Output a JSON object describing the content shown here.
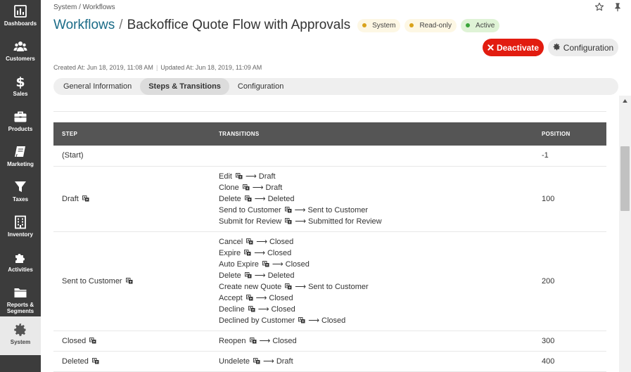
{
  "sidebar": {
    "items": [
      {
        "label": "Dashboards",
        "icon": "bar-chart-icon"
      },
      {
        "label": "Customers",
        "icon": "users-icon"
      },
      {
        "label": "Sales",
        "icon": "dollar-icon"
      },
      {
        "label": "Products",
        "icon": "briefcase-icon"
      },
      {
        "label": "Marketing",
        "icon": "book-icon"
      },
      {
        "label": "Taxes",
        "icon": "filter-icon"
      },
      {
        "label": "Inventory",
        "icon": "building-icon"
      },
      {
        "label": "Activities",
        "icon": "puzzle-icon"
      },
      {
        "label": "Reports &",
        "label2": "Segments",
        "icon": "folder-icon"
      },
      {
        "label": "System",
        "icon": "gear-icon"
      }
    ]
  },
  "breadcrumb": "System / Workflows",
  "title": {
    "link": "Workflows",
    "separator": "/",
    "name": "Backoffice Quote Flow with Approvals"
  },
  "badges": [
    {
      "label": "System",
      "type": "warn"
    },
    {
      "label": "Read-only",
      "type": "warn"
    },
    {
      "label": "Active",
      "type": "ok"
    }
  ],
  "buttons": {
    "deactivate": "Deactivate",
    "configuration": "Configuration"
  },
  "meta": {
    "created": "Created At: Jun 18, 2019, 11:08 AM",
    "divider": "|",
    "updated": "Updated At: Jun 18, 2019, 11:09 AM"
  },
  "tabs": [
    {
      "label": "General Information",
      "active": false
    },
    {
      "label": "Steps & Transitions",
      "active": true
    },
    {
      "label": "Configuration",
      "active": false
    }
  ],
  "table": {
    "headers": {
      "step": "STEP",
      "transitions": "TRANSITIONS",
      "position": "POSITION"
    },
    "arrow": "⟶",
    "rows": [
      {
        "step": "(Start)",
        "step_icon": false,
        "position": "-1",
        "transitions": []
      },
      {
        "step": "Draft",
        "step_icon": true,
        "position": "100",
        "transitions": [
          {
            "name": "Edit",
            "target": "Draft"
          },
          {
            "name": "Clone",
            "target": "Draft"
          },
          {
            "name": "Delete",
            "target": "Deleted"
          },
          {
            "name": "Send to Customer",
            "target": "Sent to Customer"
          },
          {
            "name": "Submit for Review",
            "target": "Submitted for Review"
          }
        ]
      },
      {
        "step": "Sent to Customer",
        "step_icon": true,
        "position": "200",
        "transitions": [
          {
            "name": "Cancel",
            "target": "Closed"
          },
          {
            "name": "Expire",
            "target": "Closed"
          },
          {
            "name": "Auto Expire",
            "target": "Closed"
          },
          {
            "name": "Delete",
            "target": "Deleted"
          },
          {
            "name": "Create new Quote",
            "target": "Sent to Customer"
          },
          {
            "name": "Accept",
            "target": "Closed"
          },
          {
            "name": "Decline",
            "target": "Closed"
          },
          {
            "name": "Declined by Customer",
            "target": "Closed"
          }
        ]
      },
      {
        "step": "Closed",
        "step_icon": true,
        "position": "300",
        "transitions": [
          {
            "name": "Reopen",
            "target": "Closed"
          }
        ]
      },
      {
        "step": "Deleted",
        "step_icon": true,
        "position": "400",
        "transitions": [
          {
            "name": "Undelete",
            "target": "Draft"
          }
        ]
      }
    ]
  },
  "colors": {
    "sidebar_bg": "#3c3c3c",
    "title_link": "#1a6b87",
    "deactivate_bg": "#e21c10",
    "table_header_bg": "#555555"
  }
}
